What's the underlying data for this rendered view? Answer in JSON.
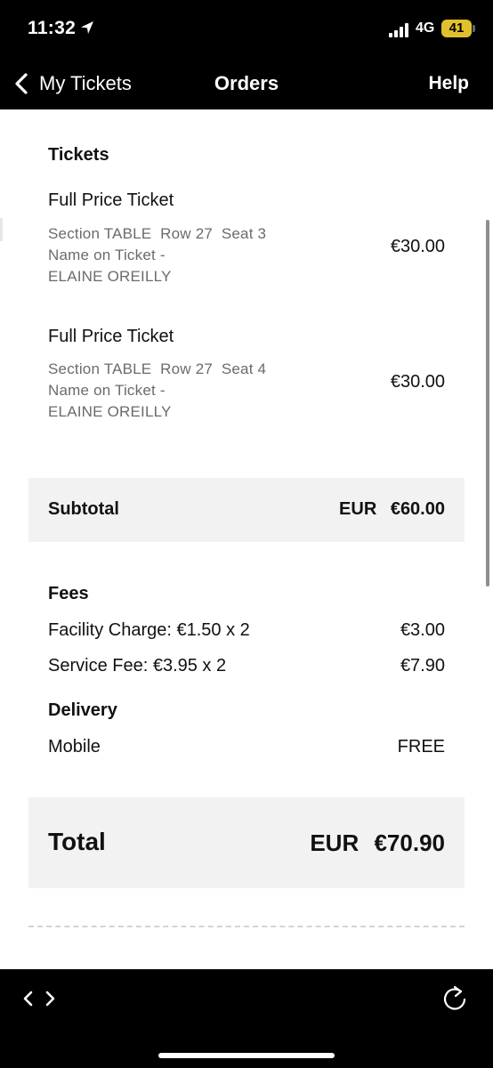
{
  "status_bar": {
    "time": "11:32",
    "network": "4G",
    "battery": "41",
    "icons": [
      "location-arrow-icon",
      "signal-bars-icon",
      "battery-icon"
    ]
  },
  "nav": {
    "back_label": "My Tickets",
    "title": "Orders",
    "help_label": "Help",
    "icons": [
      "chevron-left-icon"
    ]
  },
  "tickets": {
    "heading": "Tickets",
    "items": [
      {
        "name": "Full Price Ticket",
        "seat_line": "Section TABLE  Row 27  Seat 3",
        "name_line": "Name on Ticket -",
        "holder": "ELAINE OREILLY",
        "price": "€30.00"
      },
      {
        "name": "Full Price Ticket",
        "seat_line": "Section TABLE  Row 27  Seat 4",
        "name_line": "Name on Ticket -",
        "holder": "ELAINE OREILLY",
        "price": "€30.00"
      }
    ]
  },
  "subtotal": {
    "label": "Subtotal",
    "amount": "EUR €60.00"
  },
  "fees": {
    "heading": "Fees",
    "items": [
      {
        "label": "Facility Charge: €1.50 x 2",
        "amount": "€3.00"
      },
      {
        "label": "Service Fee: €3.95 x 2",
        "amount": "€7.90"
      }
    ]
  },
  "delivery": {
    "heading": "Delivery",
    "method": "Mobile",
    "amount": "FREE"
  },
  "total": {
    "label": "Total",
    "amount": "EUR €70.90"
  },
  "browser_bar": {
    "icons": [
      "back-arrow-icon",
      "forward-arrow-icon",
      "reload-icon"
    ]
  }
}
